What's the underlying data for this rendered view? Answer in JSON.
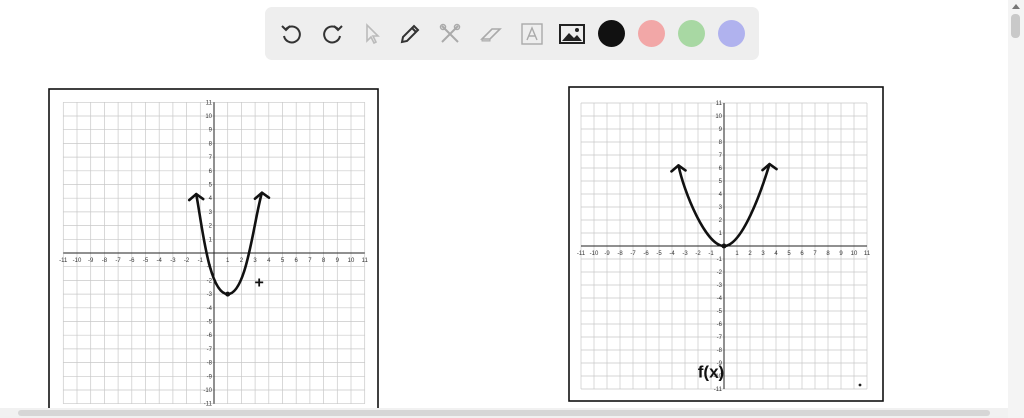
{
  "toolbar": {
    "tools": [
      {
        "name": "undo-icon",
        "label": "Undo"
      },
      {
        "name": "redo-icon",
        "label": "Redo"
      },
      {
        "name": "pointer-icon",
        "label": "Select"
      },
      {
        "name": "pen-icon",
        "label": "Pen"
      },
      {
        "name": "tools-icon",
        "label": "Tools"
      },
      {
        "name": "eraser-icon",
        "label": "Eraser"
      },
      {
        "name": "text-icon",
        "label": "Text"
      },
      {
        "name": "image-icon",
        "label": "Image"
      }
    ],
    "colors": {
      "black": "#111111",
      "red": "#f2a7a7",
      "green": "#a8d8a3",
      "blue": "#b0b2ee"
    }
  },
  "graphs": [
    {
      "id": "left",
      "x_ticks": [
        "-11",
        "-10",
        "-9",
        "-8",
        "-7",
        "-6",
        "-5",
        "-4",
        "-3",
        "-2",
        "-1",
        "1",
        "2",
        "3",
        "4",
        "5",
        "6",
        "7",
        "8",
        "9",
        "10",
        "11"
      ],
      "y_ticks": [
        "11",
        "10",
        "9",
        "8",
        "7",
        "6",
        "5",
        "4",
        "3",
        "2",
        "1",
        "-1",
        "-2",
        "-3",
        "-4",
        "-5",
        "-6",
        "-7",
        "-8",
        "-9",
        "-10",
        "-11"
      ],
      "annotation": "+",
      "curve": {
        "vertex": [
          1,
          -3
        ],
        "arms": [
          [
            -1.3,
            4.3
          ],
          [
            3.5,
            4.4
          ]
        ]
      }
    },
    {
      "id": "right",
      "x_ticks": [
        "-11",
        "-10",
        "-9",
        "-8",
        "-7",
        "-6",
        "-5",
        "-4",
        "-3",
        "-2",
        "-1",
        "1",
        "2",
        "3",
        "4",
        "5",
        "6",
        "7",
        "8",
        "9",
        "10",
        "11"
      ],
      "y_ticks": [
        "11",
        "10",
        "9",
        "8",
        "7",
        "6",
        "5",
        "4",
        "3",
        "2",
        "1",
        "-1",
        "-2",
        "-3",
        "-4",
        "-5",
        "-6",
        "-7",
        "-8",
        "-9",
        "-10",
        "-11"
      ],
      "annotation": "f(x)",
      "curve": {
        "vertex": [
          0,
          0
        ],
        "arms": [
          [
            -3.5,
            6.2
          ],
          [
            3.5,
            6.3
          ]
        ]
      }
    }
  ]
}
